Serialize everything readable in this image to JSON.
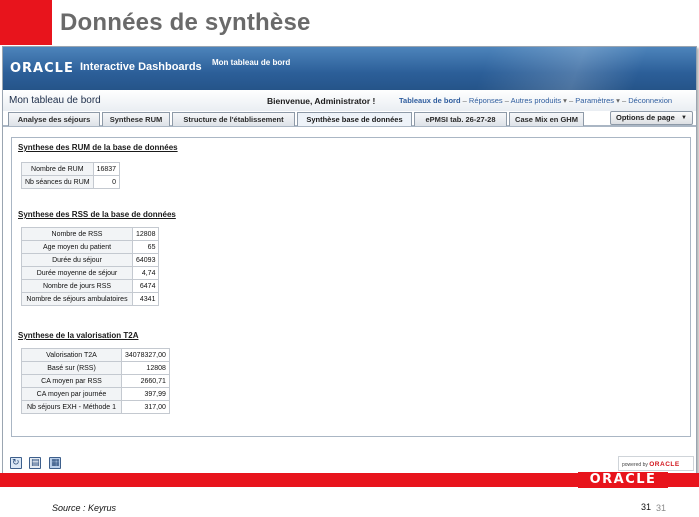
{
  "slide": {
    "title": "Données de synthèse",
    "source": "Source : Keyrus",
    "page_number": "31",
    "page_number_secondary": "31",
    "footer_logo": "ORACLE",
    "accent_color": "#e8141c"
  },
  "banner": {
    "logo": "ORACLE",
    "app_name": "Interactive Dashboards",
    "dashboard_name": "Mon tableau de bord"
  },
  "header": {
    "page_name": "Mon tableau de bord",
    "welcome": "Bienvenue, Administrator !",
    "links": {
      "dashboards": "Tableaux de bord",
      "responses": "Réponses",
      "other_products": "Autres produits",
      "settings": "Paramètres",
      "logout": "Déconnexion"
    }
  },
  "tabs": [
    {
      "label": "Analyse des séjours",
      "active": false
    },
    {
      "label": "Synthese RUM",
      "active": false
    },
    {
      "label": "Structure de l'établissement",
      "active": false
    },
    {
      "label": "Synthèse base de données",
      "active": true
    },
    {
      "label": "ePMSI tab. 26-27-28",
      "active": false
    },
    {
      "label": "Case Mix en GHM",
      "active": false
    }
  ],
  "page_options": "Options de page",
  "sections": {
    "rum": {
      "title": "Synthese des RUM de la base de données",
      "rows": [
        {
          "label": "Nombre de RUM",
          "value": "16837"
        },
        {
          "label": "Nb séances du RUM",
          "value": "0"
        }
      ]
    },
    "rss": {
      "title": "Synthese des RSS de la base de données",
      "rows": [
        {
          "label": "Nombre de RSS",
          "value": "12808"
        },
        {
          "label": "Age moyen du patient",
          "value": "65"
        },
        {
          "label": "Durée du séjour",
          "value": "64093"
        },
        {
          "label": "Durée moyenne de séjour",
          "value": "4,74"
        },
        {
          "label": "Nombre de jours RSS",
          "value": "6474"
        },
        {
          "label": "Nombre de séjours ambulatoires",
          "value": "4341"
        }
      ]
    },
    "t2a": {
      "title": "Synthese de la valorisation T2A",
      "rows": [
        {
          "label": "Valorisation T2A",
          "value": "34078327,00"
        },
        {
          "label": "Basé sur (RSS)",
          "value": "12808"
        },
        {
          "label": "CA moyen par RSS",
          "value": "2660,71"
        },
        {
          "label": "CA moyen par journée",
          "value": "397,99"
        },
        {
          "label": "Nb séjours EXH - Méthode 1",
          "value": "317,00"
        }
      ]
    }
  },
  "bottom_icons": [
    "refresh-icon",
    "print-icon",
    "export-icon"
  ],
  "powered_by": {
    "prefix": "powered by",
    "brand": "ORACLE"
  }
}
